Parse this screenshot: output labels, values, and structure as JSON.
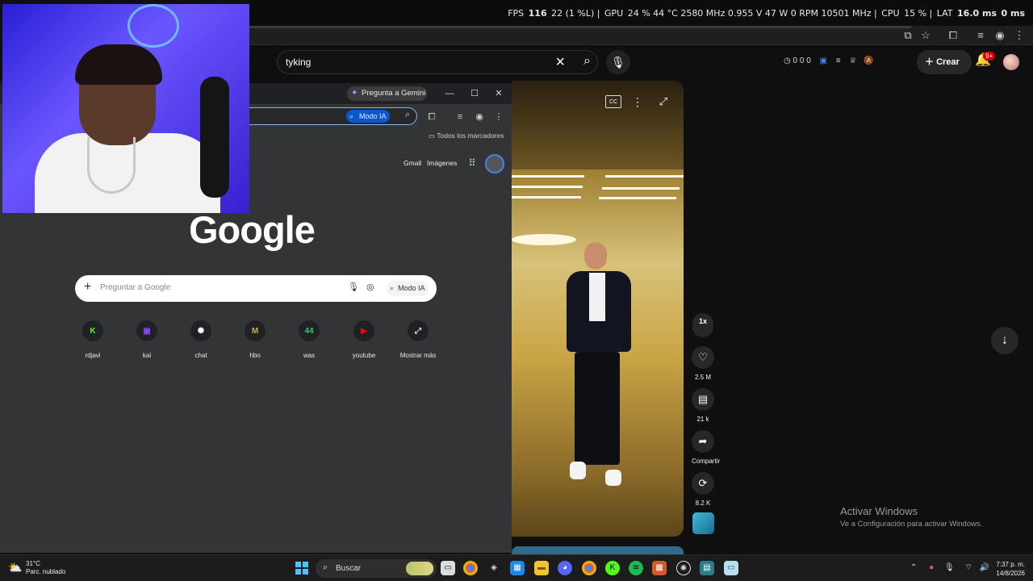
{
  "overlay": {
    "fps_label": "FPS",
    "fps_value": "116",
    "fps_low": "22 (1 %L)",
    "gpu_label": "GPU",
    "gpu_value": "24 % 44 °C 2580 MHz 0.955 V 47 W 0 RPM 10501 MHz",
    "cpu_label": "CPU",
    "cpu_value": "15 %",
    "lat_label": "LAT",
    "lat_value": "16.0 ms",
    "lat_value2": "0 ms"
  },
  "youtube": {
    "search_query": "tyking",
    "stats": "0   0   0",
    "create_label": "Crear",
    "notif_badge": "9+",
    "speed_label": "1x",
    "actions": {
      "likes": "2.5 M",
      "comments": "21 k",
      "share": "Compartir",
      "remix": "8.2 K"
    }
  },
  "chrome": {
    "gemini_label": "Pregunta a Gemini",
    "modo_ia_label": "Modo IA",
    "bookmarks_label": "Todos los marcadores",
    "gmail_label": "Gmail",
    "images_label": "Imágenes",
    "google_logo": "Google",
    "search_placeholder": "Preguntar a Google",
    "search_modo_ia": "Modo IA",
    "shortcuts": [
      {
        "label": "rdjavi",
        "glyph": "K",
        "color": "#53fc18"
      },
      {
        "label": "kai",
        "glyph": "▣",
        "color": "#9146ff"
      },
      {
        "label": "chat",
        "glyph": "✺",
        "color": "#ffffff"
      },
      {
        "label": "hbo",
        "glyph": "M",
        "color": "#c9b233"
      },
      {
        "label": "was",
        "glyph": "44",
        "color": "#25d366"
      },
      {
        "label": "youtube",
        "glyph": "▶",
        "color": "#ff0000"
      },
      {
        "label": "Mostrar más",
        "glyph": "⤢",
        "color": "#e8e8e8"
      }
    ]
  },
  "activate_windows": {
    "title": "Activar Windows",
    "subtitle": "Ve a Configuración para activar Windows."
  },
  "taskbar": {
    "weather_temp": "31°C",
    "weather_desc": "Parc. nublado",
    "search_placeholder": "Buscar",
    "time": "7:37 p. m.",
    "date": "14/8/2026"
  }
}
